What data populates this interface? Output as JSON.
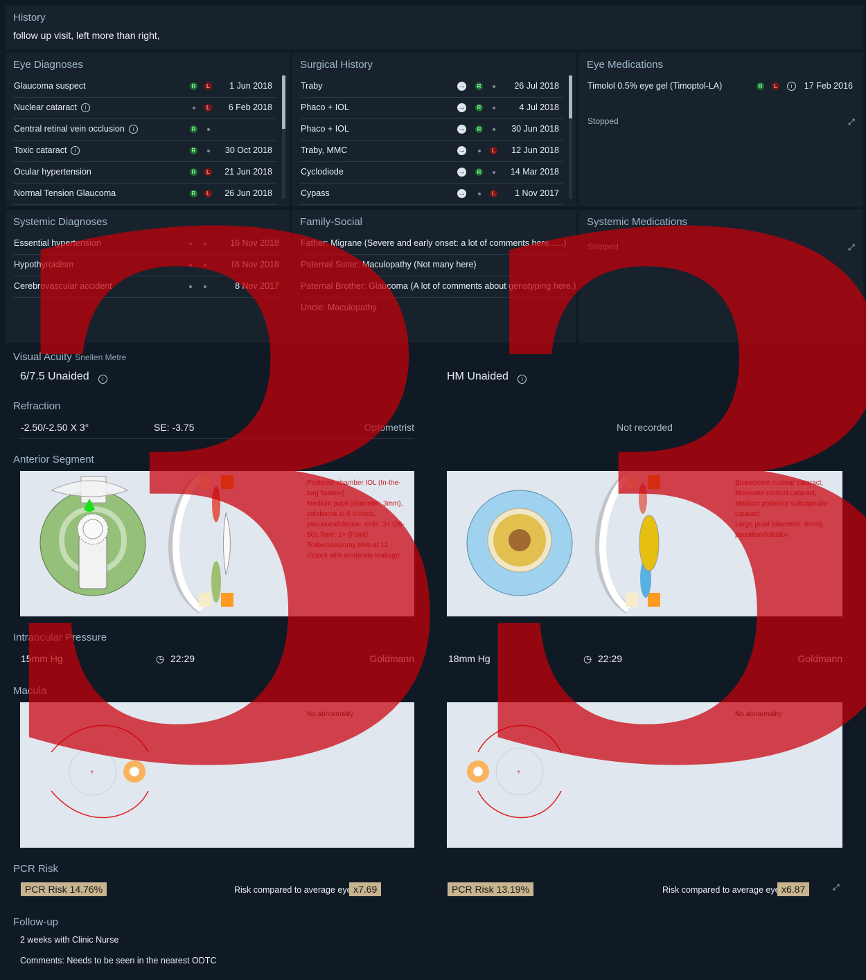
{
  "history": {
    "title": "History",
    "text": "follow up visit, left more than right,"
  },
  "eye_diagnoses": {
    "title": "Eye Diagnoses",
    "rows": [
      {
        "label": "Glaucoma suspect",
        "info": false,
        "r": true,
        "l": true,
        "date": "1 Jun 2018"
      },
      {
        "label": "Nuclear cataract",
        "info": true,
        "r": false,
        "l": true,
        "date": "6 Feb 2018"
      },
      {
        "label": "Central retinal vein occlusion",
        "info": true,
        "r": true,
        "l": false,
        "date": ""
      },
      {
        "label": "Toxic cataract",
        "info": true,
        "r": true,
        "l": false,
        "date": "30 Oct 2018"
      },
      {
        "label": "Ocular hypertension",
        "info": false,
        "r": true,
        "l": true,
        "date": "21 Jun 2018"
      },
      {
        "label": "Normal Tension Glaucoma",
        "info": false,
        "r": true,
        "l": true,
        "date": "26 Jun 2018"
      }
    ]
  },
  "surgical_history": {
    "title": "Surgical History",
    "rows": [
      {
        "label": "Traby",
        "r": true,
        "l": false,
        "date": "26 Jul 2018"
      },
      {
        "label": "Phaco + IOL",
        "r": true,
        "l": false,
        "date": "4 Jul 2018"
      },
      {
        "label": "Phaco + IOL",
        "r": true,
        "l": false,
        "date": "30 Jun 2018"
      },
      {
        "label": "Traby, MMC",
        "r": false,
        "l": true,
        "date": "12 Jun 2018"
      },
      {
        "label": "Cyclodiode",
        "r": true,
        "l": false,
        "date": "14 Mar 2018"
      },
      {
        "label": "Cypass",
        "r": false,
        "l": true,
        "date": "1 Nov 2017"
      }
    ]
  },
  "eye_medications": {
    "title": "Eye Medications",
    "rows": [
      {
        "label": "Timolol 0.5% eye gel (Timoptol-LA)",
        "date": "17 Feb 2016"
      }
    ],
    "stopped": "Stopped"
  },
  "systemic_diagnoses": {
    "title": "Systemic Diagnoses",
    "rows": [
      {
        "label": "Essential hypertension",
        "date": "16 Nov 2018"
      },
      {
        "label": "Hypothyroidism",
        "date": "16 Nov 2018"
      },
      {
        "label": "Cerebrovascular accident",
        "date": "8 Nov 2017"
      }
    ]
  },
  "family_social": {
    "title": "Family-Social",
    "rows": [
      "Father: Migrane (Severe and early onset: a lot of comments here......)",
      "Paternal Sister: Maculopathy (Not many here)",
      "Paternal Brother: Glaucoma (A lot of comments about genotyping here.)",
      "Uncle: Maculopathy"
    ]
  },
  "systemic_medications": {
    "title": "Systemic Medications",
    "stopped": "Stopped"
  },
  "visual_acuity": {
    "title": "Visual Acuity",
    "subtitle": "Snellen Metre",
    "right": "6/7.5 Unaided",
    "left": "HM Unaided"
  },
  "refraction": {
    "title": "Refraction",
    "right_value": "-2.50/-2.50 X 3°",
    "right_se": "SE: -3.75",
    "right_source": "Optometrist",
    "left": "Not recorded"
  },
  "anterior_segment": {
    "title": "Anterior Segment",
    "right_notes": [
      "Posterior chamber IOL (In-the-bag fixation)",
      "Medium pupil (diameter: 3mm), coloboma at 6 o'clock, pseudoexfoliation, cells: 3+ (26-50), flare: 1+ (Faint)",
      "Trabeculectomy bleb at 12 o'clock with moderate leakage"
    ],
    "left_notes": [
      "Brunescent nuclear cataract, Moderate cortical cataract, Medium posterior subcapsular cataract",
      "Large pupil (diameter: 6mm), pseudoexfoliation"
    ]
  },
  "iop": {
    "title": "Intraocular Pressure",
    "right": {
      "value": "15mm Hg",
      "time": "22:29",
      "method": "Goldmann"
    },
    "left": {
      "value": "18mm Hg",
      "time": "22:29",
      "method": "Goldmann"
    }
  },
  "macula": {
    "title": "Macula",
    "right_note": "No abnormality",
    "left_note": "No abnormality"
  },
  "pcr": {
    "title": "PCR Risk",
    "right": {
      "risk": "PCR Risk 14.76%",
      "compare_label": "Risk compared to average eye",
      "compare_value": "x7.69"
    },
    "left": {
      "risk": "PCR Risk 13.19%",
      "compare_label": "Risk compared to average eye",
      "compare_value": "x6.87"
    }
  },
  "follow_up": {
    "title": "Follow-up",
    "line1": "2 weeks with Clinic Nurse",
    "line2": "Comments: Needs to be seen in the nearest ODTC"
  },
  "badges": {
    "r": "R",
    "l": "L"
  },
  "watermark": {
    "glyph": "33",
    "color": "#c8000a"
  },
  "colors": {
    "background": "#101a25",
    "panel": "#17222d",
    "section_title": "#9fb7c9",
    "badge_green": "#1d6b30",
    "badge_red": "#7a1616",
    "pcr_tag": "#c8b48f"
  }
}
